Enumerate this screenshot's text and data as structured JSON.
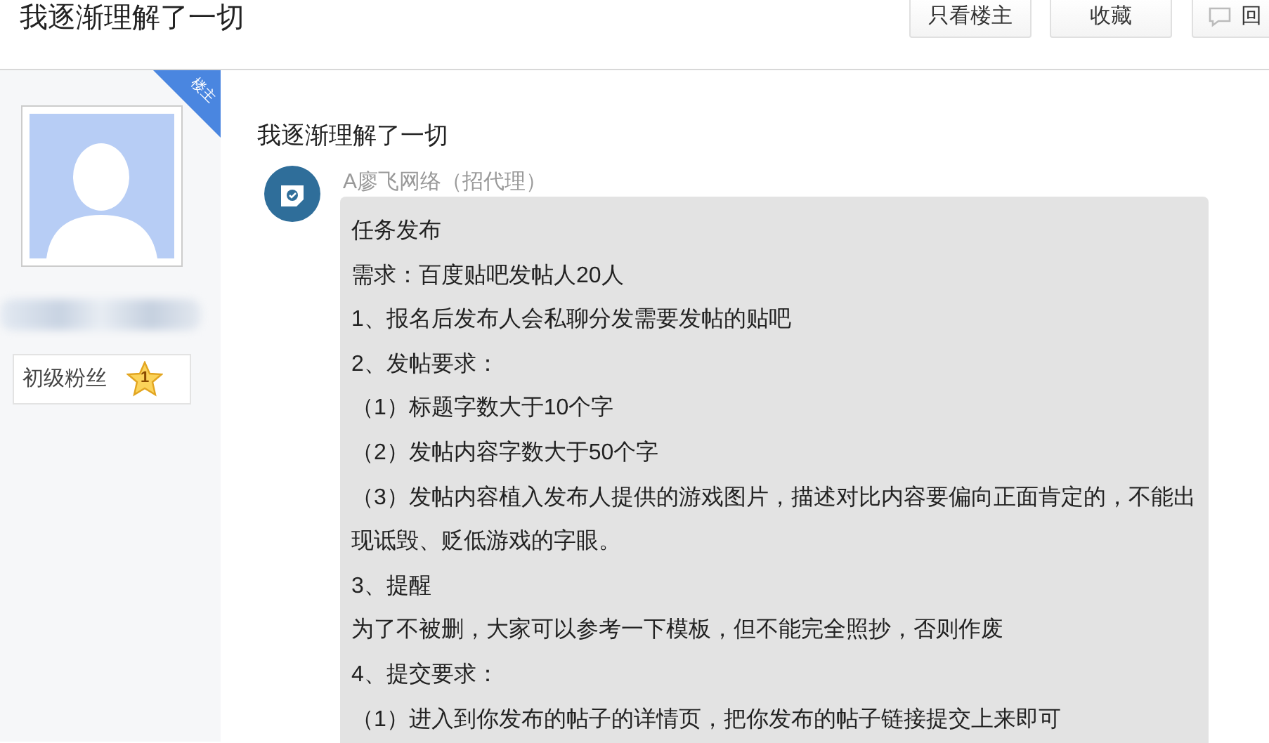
{
  "header": {
    "title": "我逐渐理解了一切",
    "buttons": [
      {
        "label": "只看楼主",
        "kind": "plain"
      },
      {
        "label": "收藏",
        "kind": "plain"
      },
      {
        "label": "回",
        "kind": "reply"
      }
    ]
  },
  "author": {
    "ribbon": "楼主",
    "level_name": "初级粉丝",
    "level_number": "1"
  },
  "post": {
    "title": "我逐渐理解了一切",
    "message": {
      "sender": "A廖飞网络（招代理）",
      "lines": [
        "任务发布",
        "需求：百度贴吧发帖人20人",
        "1、报名后发布人会私聊分发需要发帖的贴吧",
        "2、发帖要求：",
        "（1）标题字数大于10个字",
        "（2）发帖内容字数大于50个字",
        "（3）发帖内容植入发布人提供的游戏图片，描述对比内容要偏向正面肯定的，不能出现诋毁、贬低游戏的字眼。",
        "3、提醒",
        "为了不被删，大家可以参考一下模板，但不能完全照抄，否则作废",
        "4、提交要求：",
        "（1）进入到你发布的帖子的详情页，把你发布的帖子链接提交上来即可"
      ]
    }
  }
}
